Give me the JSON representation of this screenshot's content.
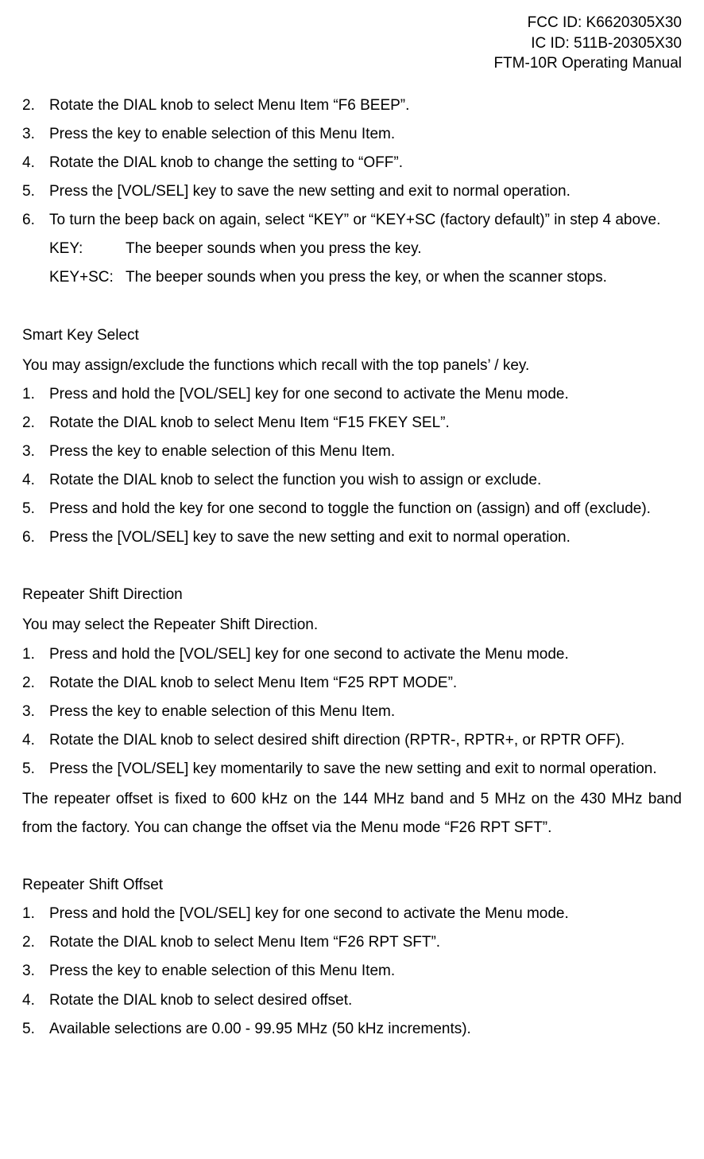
{
  "header": {
    "fcc": "FCC ID: K6620305X30",
    "ic": "IC ID: 511B-20305X30",
    "manual": "FTM-10R Operating Manual"
  },
  "section1": {
    "items": [
      {
        "n": "2.",
        "t": "Rotate the DIAL knob to select Menu Item “F6 BEEP”."
      },
      {
        "n": "3.",
        "t": "Press the   key to enable selection of this Menu Item."
      },
      {
        "n": "4.",
        "t": "Rotate the DIAL knob to change the setting to “OFF”."
      },
      {
        "n": "5.",
        "t": "Press the [VOL/SEL] key to save the new setting and exit to normal operation."
      },
      {
        "n": "6.",
        "t": "To turn the beep back on again, select “KEY” or “KEY+SC (factory default)” in step 4 above."
      }
    ],
    "sub": [
      {
        "label": "KEY:",
        "text": "The beeper sounds when you press the key."
      },
      {
        "label": "KEY+SC:",
        "text": "The beeper sounds when you press the key, or when the scanner stops."
      }
    ]
  },
  "section2": {
    "title": "Smart Key Select",
    "intro": "You may assign/exclude the functions which recall with the top panels’   /   key.",
    "items": [
      {
        "n": "1.",
        "t": "Press and hold the [VOL/SEL] key for one second to activate the Menu mode."
      },
      {
        "n": "2.",
        "t": "Rotate the DIAL knob to select Menu Item “F15 FKEY SEL”."
      },
      {
        "n": "3.",
        "t": "Press the   key to enable selection of this Menu Item."
      },
      {
        "n": "4.",
        "t": "Rotate the DIAL knob to select the function you wish to assign or exclude."
      },
      {
        "n": "5.",
        "t": "Press and hold the   key for one second to toggle the function on (assign) and off (exclude)."
      },
      {
        "n": "6.",
        "t": "Press the [VOL/SEL] key to save the new setting and exit to normal operation."
      }
    ]
  },
  "section3": {
    "title": "Repeater Shift Direction",
    "intro": "You may select the Repeater Shift Direction.",
    "items": [
      {
        "n": "1.",
        "t": "Press and hold the [VOL/SEL] key for one second to activate the Menu mode."
      },
      {
        "n": "2.",
        "t": "Rotate the DIAL knob to select Menu Item “F25 RPT MODE”."
      },
      {
        "n": "3.",
        "t": "Press the   key to enable selection of this Menu Item."
      },
      {
        "n": "4.",
        "t": "Rotate the DIAL knob to select desired shift direction (RPTR-, RPTR+, or RPTR OFF)."
      },
      {
        "n": "5.",
        "t": "Press the [VOL/SEL] key momentarily to save the new setting and exit to normal operation."
      }
    ],
    "note": "The repeater offset is fixed to 600 kHz on the 144 MHz band and 5 MHz on the 430 MHz band from the factory. You can change the offset via the Menu mode “F26 RPT SFT”."
  },
  "section4": {
    "title": "Repeater Shift Offset",
    "items": [
      {
        "n": "1.",
        "t": "Press and hold the [VOL/SEL] key for one second to activate the Menu mode."
      },
      {
        "n": "2.",
        "t": "Rotate the DIAL knob to select Menu Item “F26 RPT SFT”."
      },
      {
        "n": "3.",
        "t": "Press the   key to enable selection of this Menu Item."
      },
      {
        "n": "4.",
        "t": "Rotate the DIAL knob to select desired offset."
      },
      {
        "n": "5.",
        "t": "Available selections are 0.00 - 99.95 MHz (50 kHz increments)."
      }
    ]
  }
}
